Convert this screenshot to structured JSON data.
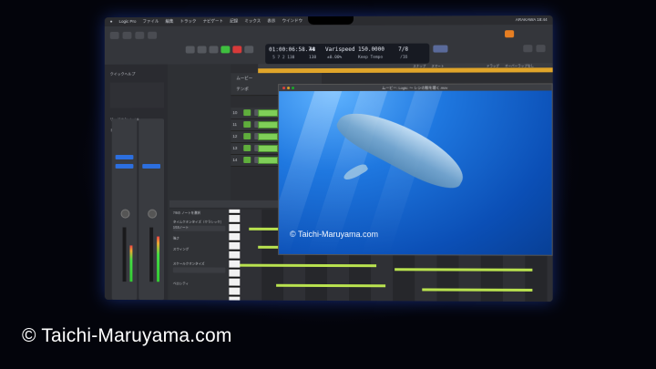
{
  "menu": {
    "app": "Logic Pro",
    "items": [
      "ファイル",
      "編集",
      "トラック",
      "ナビゲート",
      "記録",
      "ミックス",
      "表示",
      "ウインドウ",
      "1",
      "ヘルプ"
    ],
    "clock": "ARAKAWA 18:44"
  },
  "transport": {
    "timecode": "01:00:06:58.74",
    "bars": "5 7 2 138",
    "value_48": "48",
    "value_138": "138",
    "varispeed_label": "Varispeed",
    "varispeed_value": "±0.00%",
    "tempo": "150.0000",
    "keep_tempo": "Keep Tempo",
    "time_sig": "7/8",
    "division": "/16"
  },
  "quickhelp": {
    "title": "クイックヘルプ",
    "track_rows": [
      "リージョン: Inst 9",
      "トラック: Inst 9"
    ]
  },
  "tracks": {
    "header_rows": [
      "ムービー",
      "テンポ"
    ],
    "list": [
      {
        "num": "10",
        "name": "Inst 9"
      },
      {
        "num": "11",
        "name": "Inst 10"
      },
      {
        "num": "12",
        "name": "Inst 11"
      },
      {
        "num": "13",
        "name": "Inst 12"
      },
      {
        "num": "14",
        "name": "Inst 13"
      }
    ],
    "region_labels": [
      "Inst 9",
      "Inst 10",
      "Inst 11",
      "Inst 12",
      "Inst 13"
    ]
  },
  "ruler": {
    "snap_label": "スナップ",
    "snap_value": "スマート",
    "drag_label": "ドラッグ",
    "drag_value": "オーバーラップなし"
  },
  "pianoroll": {
    "title": "7/8の ノートを選択",
    "controls": [
      "タイムクオンタイズ（クラシック）",
      "1/16ノート",
      "強さ",
      "スウィング",
      "スケールクオンタイズ",
      "ベロシティ"
    ]
  },
  "movie": {
    "title": "ムービー: Logic: ～ レシの鯨を聴く.mov",
    "watermark": "© Taichi-Maruyama.com"
  },
  "photo_watermark": "© Taichi-Maruyama.com",
  "colors": {
    "region_green": "#7fcf58",
    "cycle_yellow": "#e0a52a",
    "ocean_blue": "#1f78e0"
  }
}
